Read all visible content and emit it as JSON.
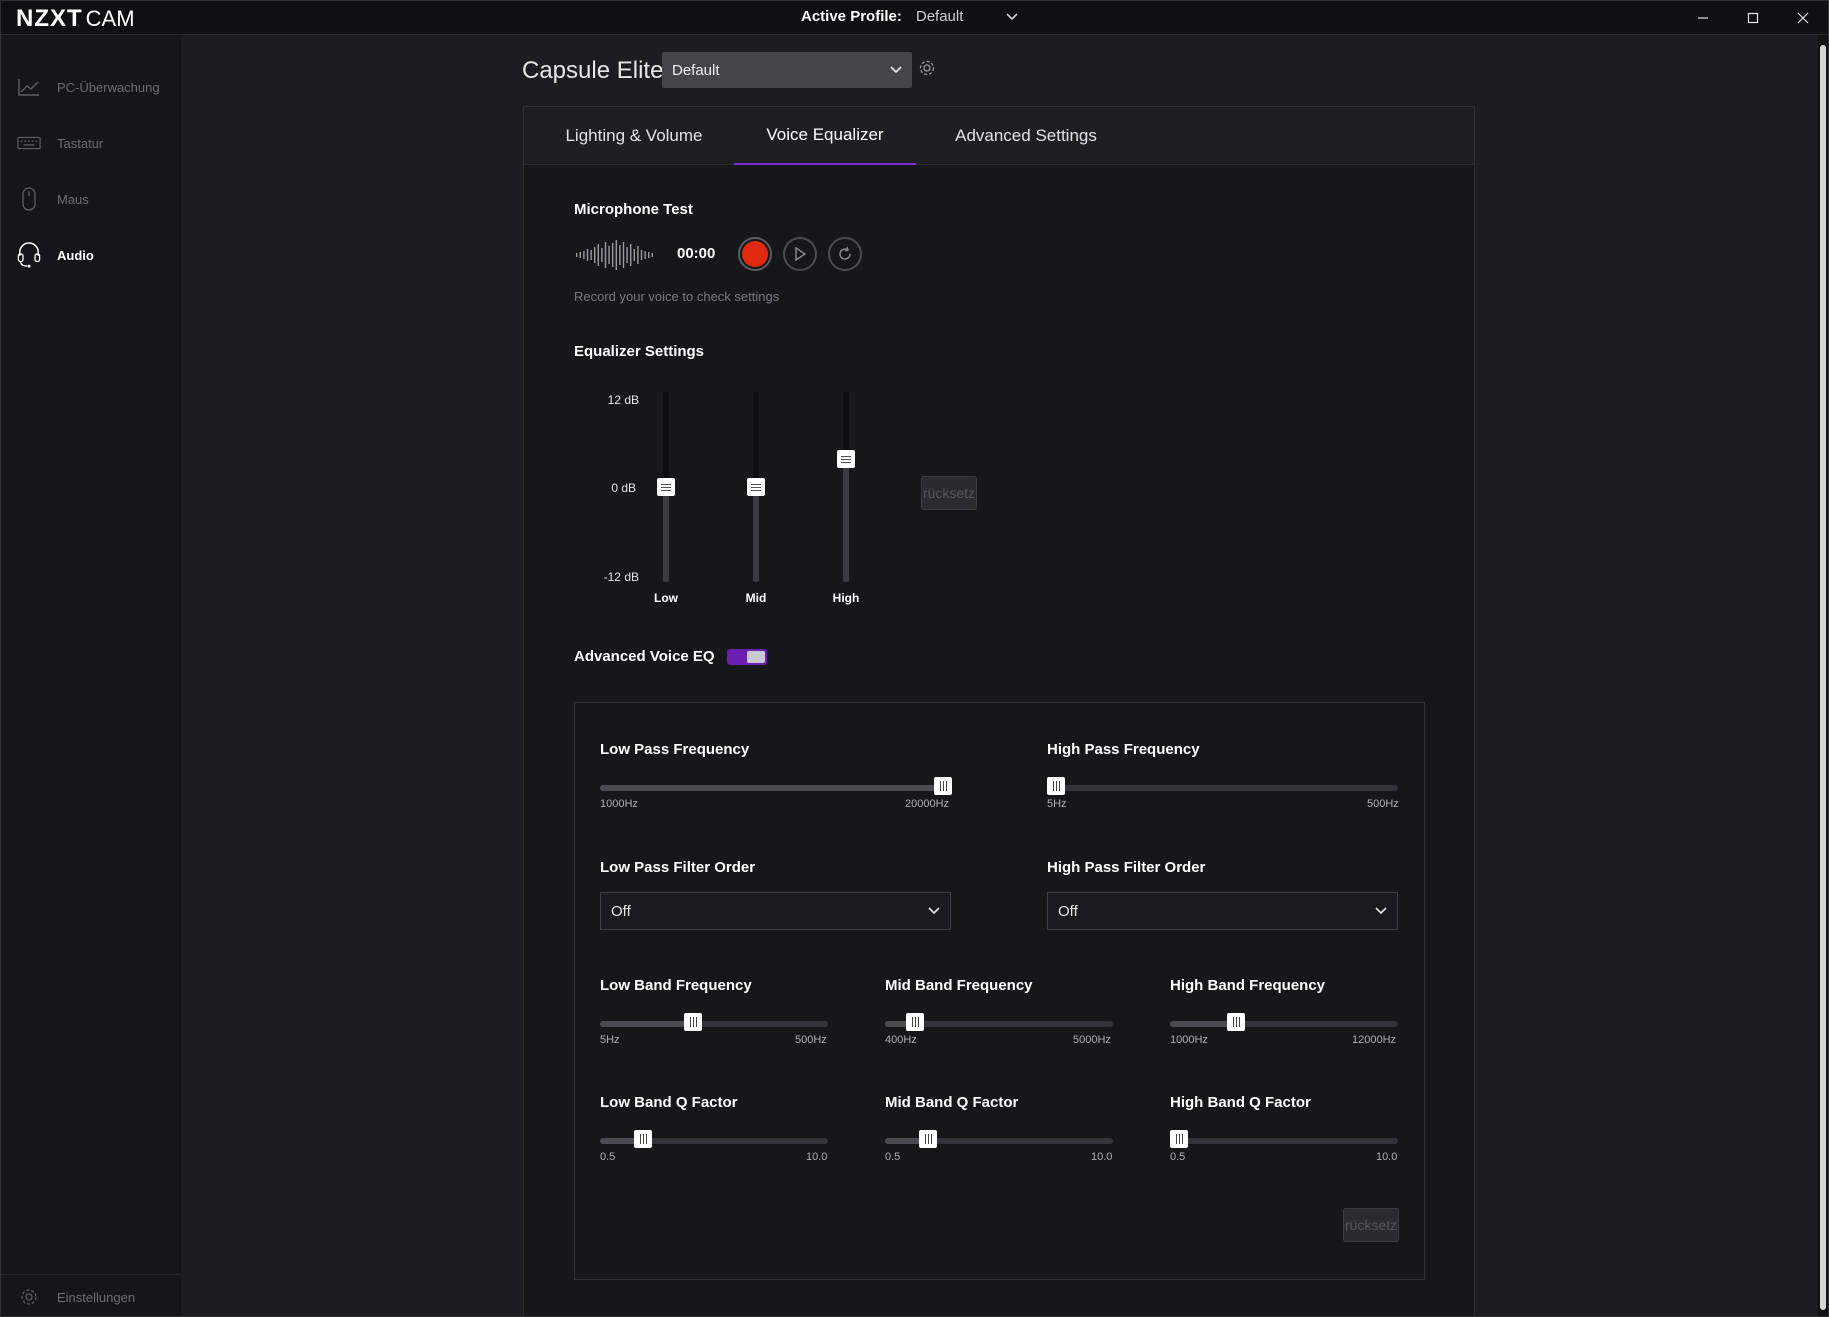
{
  "titlebar": {
    "brand": "NZXT",
    "product": "CAM",
    "profile_label": "Active Profile:",
    "profile_value": "Default"
  },
  "sidebar": {
    "items": [
      {
        "label": "PC-Überwachung",
        "icon": "chart-icon"
      },
      {
        "label": "Tastatur",
        "icon": "keyboard-icon"
      },
      {
        "label": "Maus",
        "icon": "mouse-icon"
      },
      {
        "label": "Audio",
        "icon": "headset-icon",
        "active": true
      }
    ],
    "settings_label": "Einstellungen"
  },
  "device": {
    "name": "Capsule Elite",
    "profile_select": "Default"
  },
  "tabs": [
    {
      "label": "Lighting & Volume"
    },
    {
      "label": "Voice Equalizer",
      "active": true
    },
    {
      "label": "Advanced Settings"
    }
  ],
  "mic_test": {
    "title": "Microphone Test",
    "time": "00:00",
    "hint": "Record your voice to check settings"
  },
  "equalizer": {
    "title": "Equalizer Settings",
    "scale": [
      "12 dB",
      "0 dB",
      "-12 dB"
    ],
    "range_db": [
      -12,
      12
    ],
    "bands": [
      {
        "label": "Low",
        "value_db": 0
      },
      {
        "label": "Mid",
        "value_db": 0
      },
      {
        "label": "High",
        "value_db": 3.5
      }
    ],
    "reset_label": "rücksetz"
  },
  "advanced_voice_eq": {
    "label": "Advanced Voice EQ",
    "enabled": true
  },
  "advanced": {
    "low_pass_freq": {
      "title": "Low Pass Frequency",
      "min": "1000Hz",
      "max": "20000Hz",
      "fraction": 1.0
    },
    "high_pass_freq": {
      "title": "High Pass Frequency",
      "min": "5Hz",
      "max": "500Hz",
      "fraction": 0.0
    },
    "low_pass_order": {
      "title": "Low Pass Filter Order",
      "value": "Off"
    },
    "high_pass_order": {
      "title": "High Pass Filter Order",
      "value": "Off"
    },
    "low_band_freq": {
      "title": "Low Band Frequency",
      "min": "5Hz",
      "max": "500Hz",
      "fraction": 0.4
    },
    "mid_band_freq": {
      "title": "Mid Band Frequency",
      "min": "400Hz",
      "max": "5000Hz",
      "fraction": 0.1
    },
    "high_band_freq": {
      "title": "High Band Frequency",
      "min": "1000Hz",
      "max": "12000Hz",
      "fraction": 0.27
    },
    "low_band_q": {
      "title": "Low Band Q Factor",
      "min": "0.5",
      "max": "10.0",
      "fraction": 0.16
    },
    "mid_band_q": {
      "title": "Mid Band Q Factor",
      "min": "0.5",
      "max": "10.0",
      "fraction": 0.16
    },
    "high_band_q": {
      "title": "High Band Q Factor",
      "min": "0.5",
      "max": "10.0",
      "fraction": 0.0
    },
    "reset_label": "rücksetz"
  },
  "colors": {
    "accent": "#7b2fd6",
    "record": "#e1290f"
  }
}
